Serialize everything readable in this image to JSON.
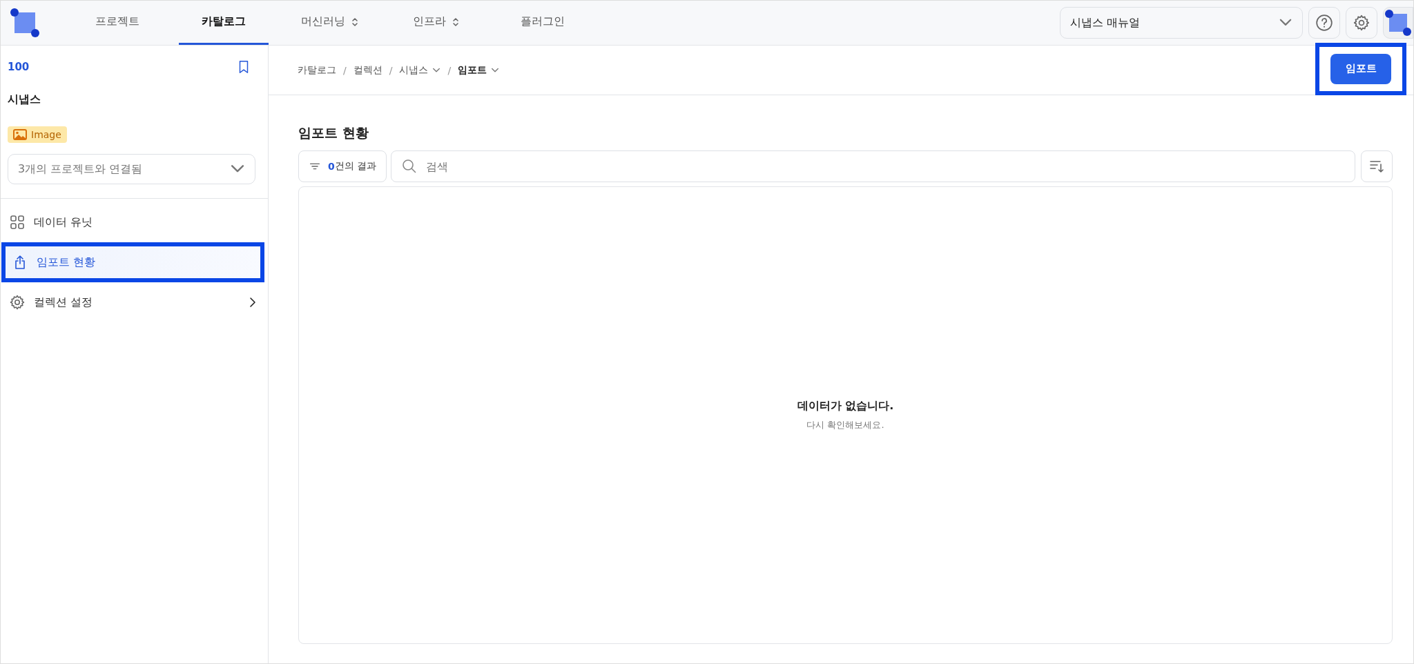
{
  "nav": {
    "tabs": [
      {
        "label": "프로젝트",
        "selected": false,
        "has_menu": false
      },
      {
        "label": "카탈로그",
        "selected": true,
        "has_menu": false
      },
      {
        "label": "머신러닝",
        "selected": false,
        "has_menu": true
      },
      {
        "label": "인프라",
        "selected": false,
        "has_menu": true
      },
      {
        "label": "플러그인",
        "selected": false,
        "has_menu": false
      }
    ],
    "manual_select": {
      "value": "시냅스 매뉴얼"
    }
  },
  "sidebar": {
    "count": "100",
    "title": "시냅스",
    "tag": "Image",
    "projects_select": {
      "value": "3개의 프로젝트와 연결됨"
    },
    "items": [
      {
        "label": "데이터 유닛",
        "selected": false,
        "highlighted": false,
        "has_submenu": false
      },
      {
        "label": "임포트 현황",
        "selected": true,
        "highlighted": true,
        "has_submenu": false
      },
      {
        "label": "컬렉션 설정",
        "selected": false,
        "highlighted": false,
        "has_submenu": true
      }
    ]
  },
  "breadcrumb": [
    {
      "label": "카탈로그",
      "has_menu": false,
      "current": false
    },
    {
      "separator": "/",
      "label": "컬렉션",
      "has_menu": false,
      "current": false
    },
    {
      "separator": "/",
      "label": "시냅스",
      "has_menu": true,
      "current": false
    },
    {
      "separator": "/",
      "label": "임포트",
      "has_menu": true,
      "current": true
    }
  ],
  "import_button": {
    "label": "임포트",
    "highlighted": true
  },
  "section_title": "임포트 현황",
  "filter_button": {
    "count": "0",
    "label": "건의 결과"
  },
  "search": {
    "placeholder": "검색"
  },
  "empty_state": {
    "title": "데이터가 없습니다.",
    "message": "다시 확인해보세요."
  }
}
